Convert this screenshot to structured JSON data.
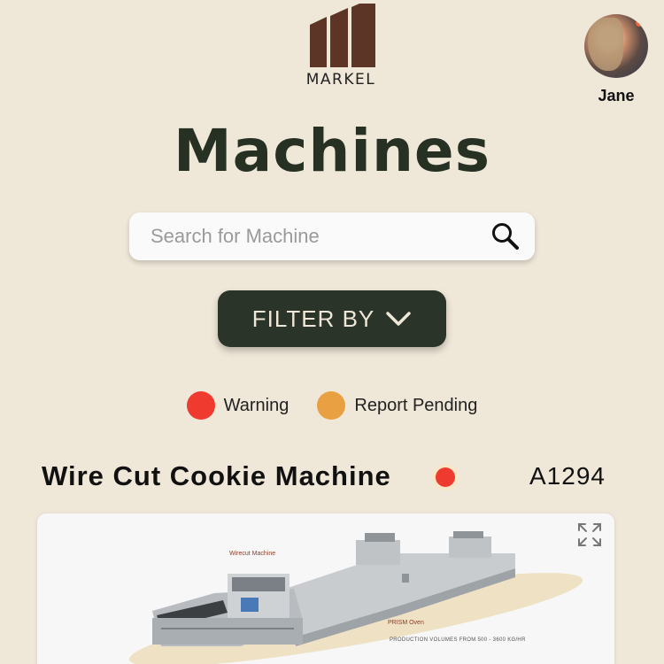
{
  "brand": {
    "name": "MARKEL",
    "color": "#5c3526"
  },
  "user": {
    "name": "Jane"
  },
  "page": {
    "title": "Machines"
  },
  "search": {
    "placeholder": "Search for Machine",
    "value": ""
  },
  "filter": {
    "label": "FILTER BY"
  },
  "legend": [
    {
      "label": "Warning",
      "color": "#ef3b2f"
    },
    {
      "label": "Report Pending",
      "color": "#e9a043"
    }
  ],
  "machine": {
    "name": "Wire Cut Cookie Machine",
    "id": "A1294",
    "status": "warning",
    "image": {
      "callout_top": "Wirecut Machine",
      "callout_bottom": "PRISM Oven",
      "production_text": "PRODUCTION VOLUMES  FROM 500 - 3600 KG/HR"
    }
  },
  "colors": {
    "background": "#efe7d8",
    "dark_green": "#2a3428"
  }
}
